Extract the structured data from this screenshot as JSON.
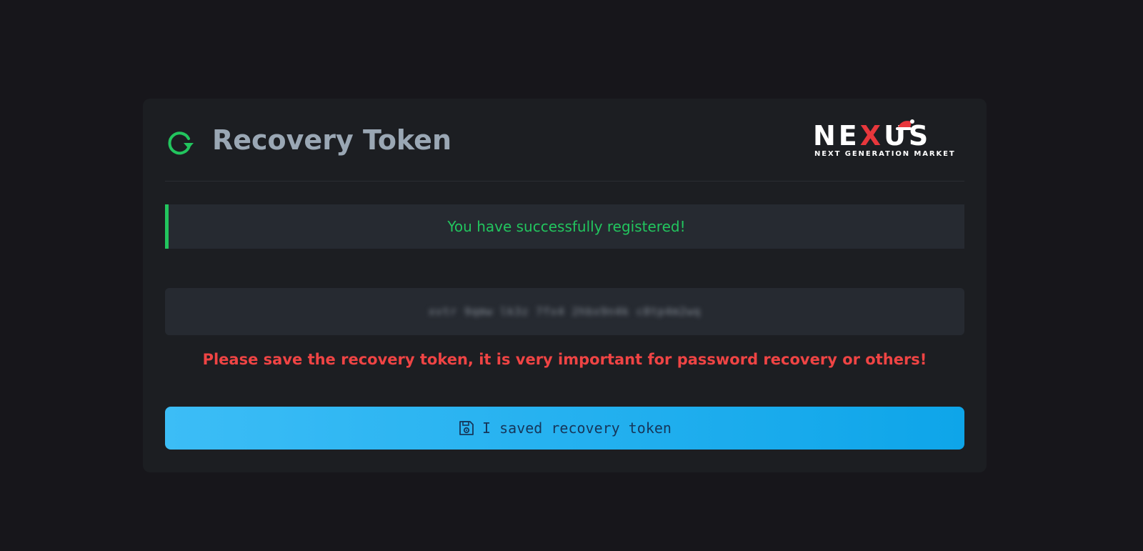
{
  "header": {
    "title": "Recovery Token",
    "icon": "refresh-icon",
    "logo": {
      "word_left": "NE",
      "word_x": "X",
      "word_right": "US",
      "tagline": "NEXT GENERATION MARKET"
    }
  },
  "alert": {
    "message": "You have successfully registered!",
    "color": "#22c55e"
  },
  "token": {
    "value": "xvtr  9qmw  lk3z  7fx4  2hbx9n4k  c8tp4m2wq"
  },
  "warning": {
    "text": "Please save the recovery token, it is very important for password recovery or others!",
    "color": "#ef4444"
  },
  "action": {
    "label": "I saved recovery token",
    "icon": "floppy-disk-icon"
  },
  "colors": {
    "background": "#17161b",
    "card": "#1c1e22",
    "accent": "#0ea5e9"
  }
}
